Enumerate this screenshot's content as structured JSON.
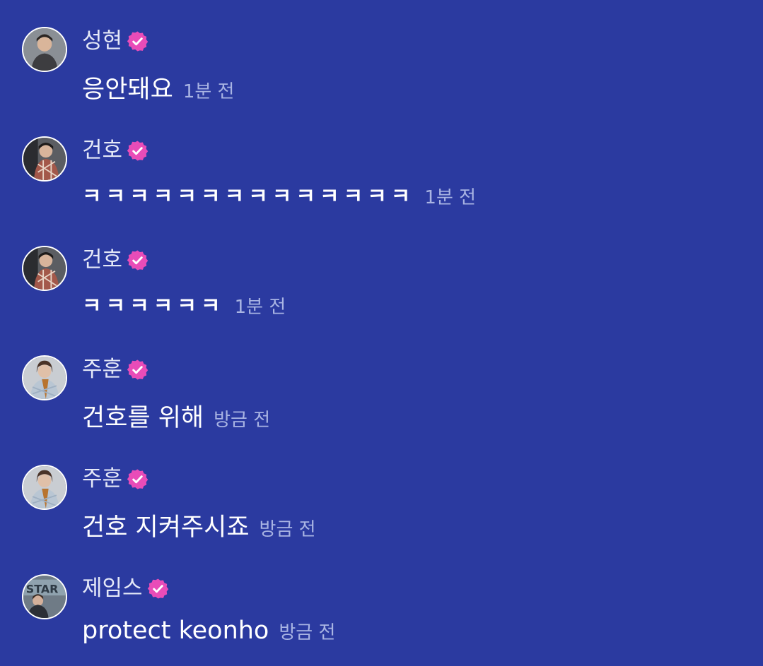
{
  "colors": {
    "background": "#2b3aa0",
    "badge": "#e94cb8",
    "timestamp": "#a9b4e3"
  },
  "messages": [
    {
      "author": "성현",
      "verified": true,
      "avatar_icon": "user-avatar-photo",
      "text": "응안돼요",
      "time": "1분 전"
    },
    {
      "author": "건호",
      "verified": true,
      "avatar_icon": "user-avatar-photo",
      "text": "ㅋㅋㅋㅋㅋㅋㅋㅋㅋㅋㅋㅋㅋㅋ",
      "time": "1분 전"
    },
    {
      "author": "건호",
      "verified": true,
      "avatar_icon": "user-avatar-photo",
      "text": "ㅋㅋㅋㅋㅋㅋ",
      "time": "1분 전"
    },
    {
      "author": "주훈",
      "verified": true,
      "avatar_icon": "user-avatar-photo",
      "text": "건호를 위해",
      "time": "방금 전"
    },
    {
      "author": "주훈",
      "verified": true,
      "avatar_icon": "user-avatar-photo",
      "text": "건호 지켜주시죠",
      "time": "방금 전"
    },
    {
      "author": "제임스",
      "verified": true,
      "avatar_icon": "user-avatar-photo",
      "text": "protect keonho",
      "time": "방금 전"
    }
  ]
}
